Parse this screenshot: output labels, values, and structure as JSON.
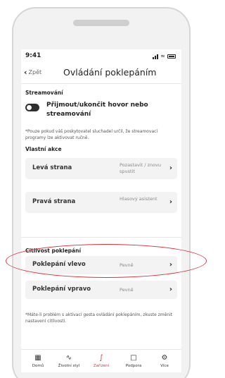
{
  "status_bar": {
    "time": "9:41"
  },
  "header": {
    "back_label": "Zpět",
    "title": "Ovládání poklepáním"
  },
  "streaming": {
    "section_title": "Streamování",
    "toggle_label": "Přijmout/ukončit hovor nebo streamování",
    "toggle_on": false,
    "note": "*Pouze pokud váš poskytovatel sluchadel určil, že streamovací programy lze aktivovat ručně."
  },
  "custom_actions": {
    "section_title": "Vlastní akce",
    "items": [
      {
        "label": "Levá strana",
        "value": "Pozastavit / znovu spustit"
      },
      {
        "label": "Pravá strana",
        "value": "Hlasový asistent"
      }
    ]
  },
  "sensitivity": {
    "section_title": "Citlivost poklepání",
    "items": [
      {
        "label": "Poklepání vlevo",
        "value": "Pevně"
      },
      {
        "label": "Poklepání vpravo",
        "value": "Pevně"
      }
    ],
    "note": "*Máte-li problém s aktivací gesta ovládání poklepáním, zkuste změnit nastavení citlivosti."
  },
  "tabbar": {
    "items": [
      {
        "label": "Domů",
        "icon": "home-grid-icon"
      },
      {
        "label": "Životní styl",
        "icon": "activity-icon"
      },
      {
        "label": "Zařízení",
        "icon": "hearing-aid-icon",
        "active": true
      },
      {
        "label": "Podpora",
        "icon": "chat-bubble-icon"
      },
      {
        "label": "Více",
        "icon": "gear-icon"
      }
    ]
  },
  "colors": {
    "accent": "#d7323c",
    "card_bg": "#f3f3f3",
    "text": "#222222"
  }
}
